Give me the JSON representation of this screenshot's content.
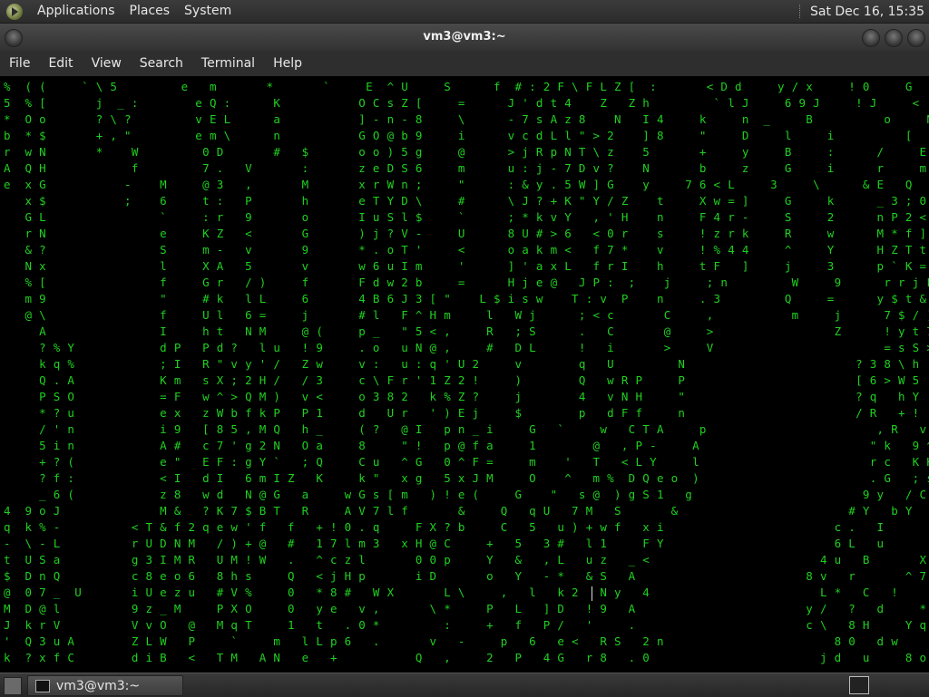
{
  "top_panel": {
    "menu": [
      "Applications",
      "Places",
      "System"
    ],
    "clock": "Sat Dec 16, 15:35"
  },
  "window": {
    "title": "vm3@vm3:~",
    "menu": [
      "File",
      "Edit",
      "View",
      "Search",
      "Terminal",
      "Help"
    ]
  },
  "terminal": {
    "content": "%  ( (     ` \\ 5         e   m       *       `     E  ^ U     S      f  # : 2 F \\ F L Z [  :       < D d     y / x     ! 0     G    U F ?\n5  % [       j  _ :        e Q :      K           O C s Z [     =      J ' d t 4    Z   Z h         ` l J     6 9 J     ! J     <    ? 1 6\n*  O o       ? \\ ?         v E L      a           ] - n - 8     \\      - 7 s A z 8    N   I 4     k     n  _     B          o     N    [ I .\nb  * $       + , \"         e m \\      n           G O @ b 9     i      v c d L l \" > 2    ] 8     \"     D     l     i          [     \"    Z . C\nr  w N       *    W         0 D       #   $       o o ) 5 g     @      > j R p N T \\ z    5       +     y     B     :      /     E     $    r t\nA  Q H            f         7 .   V       :       z e D S 6     m      u : j - 7 D v ?    N       b     z     G     i      r     m     e    %\ne  x G           -    M     @ 3   ,       M       x r W n ;     \"      : & y . 5 W ] G    y     7 6 < L     3     \\      & E   Q     m    =\n   x $           ;    6     t :   P       h       e T Y D \\     #      \\ J ? + K \" Y / Z    t     X w = ]     G     k      _ 3 ; 0     A    V\n   G L                `     : r   9       o       I u S l $     `      ; * k v Y   , ' H    n     F 4 r -     S     2      n P 2 <     p    P\n   r N                e     K Z   <       G       ) j ? V -     U      8 U # > 6   < 0 r    s     ! z r k     R     w      M * f ]     Z    K\n   & ?                S     m -   v       9       * . o T '     <      o a k m <   f 7 *    v     ! % 4 4     ^     Y      H Z T t     \\    i\n   N x                l     X A   5       v       w 6 u I m     '      ] ' a x L   f r I    h     t F   ]     j     3      p ` K =     i    Z\n   % [                f     G r   / )     f       F d w 2 b     =      H j e @   J P :  ;    j     ; n         W     9      r r j F     i    V\n   m 9                \"     # k   l L     6       4 B 6 J 3 [ \"    L $ i s w    T : v  P    n     . 3         Q     =      y $ t &     5    a\n   @ \\                f     U l   6 =     j       # l   F ^ H m     l   W j      ; < c       C     ,           m     j      7 $ / )     7    \\\n     A                I     h t   N M     @ (     p _   \" 5 < ,     R   ; S      .   C       @     >                 Z      ! y t 7 .\n     ? % Y            d P   P d ?   l u   ! 9     . o   u N @ ,     #   D L      !   i       >     V                        = s S >     h\n     k q %            ; I   R \" v y ' /   Z w     v :   u : q ' U 2     v        q   U         N                        ? 3 8 \\ h   I\n     Q . A            K m   s X ; 2 H /   / 3     c \\ F r ' 1 Z 2 !     )        Q   w R P     P                        [ 6 > W 5   \\\n     P S O            = F   w ^ > Q M )   v <     o 3 8 2   k % Z ?     j        4   v N H     \"                        ? q   h Y\n     * ? u            e x   z W b f k P   P 1     d   U r   ' ) E j     $        p   d F f     n                        / R   + !\n     / ' n            i 9   [ 8 5 , M Q   h _     ( ?   @ I   p n _ i     G   `     w   C T A     p                        , R   v :\n     5 i n            A #   c 7 ' g 2 N   O a     8     \" !   p @ f a     1        @   , P -     A                        \" k   9 ^\n     + ? (            e \"   E F : g Y `   ; Q     C u   ^ G   0 ^ F =     m    '   T   < L Y     l                        r c   K K     L\n     ? f :            < I   d I   6 m I Z   K     k \"   x g   5 x J M     O    ^   m %  D Q e o  )                        . G   ; s     y\n     _ 6 (            z 8   w d   N @ G   a     w G s [ m   ) ! e (     G    \"   s @  ) g S 1   g                        9 y   / C     ,\n4  9 o J              M &   ? K 7 $ B T   R     A V 7 l f       &     Q   q U   7 M   S       &                        # Y   b Y     F\nq  k % -          < T & f 2 q e w ' f   f   + ! 0 . q     F X ? b     C   5   u ) + w f   x i                        c .   I       K\n-  \\ - L          r U D N M   / ) + @   #   1 7 l m 3   x H @ C     +   5   3 #   l 1     F Y                        6 L   u       \\\nt  U S a          g 3 I M R   U M ! W   .   ^ c z l       0 0 p     Y   &   , L   u z   _ <                        4 u   B       X , 9 t\n$  D n Q          c 8 e o 6   8 h s     Q   < j H p       i D       o   Y   - *   & S   A                        8 v   r       ^ 7 H H\n@  0 7 _  U       i U e z u   # V %     0   * 8 #   W X       L \\     ,   l   k 2   N y   4                        L *   C   !     ) m 5 #\nM  D @ l          9 z _ M     P X O     0   y e   v ,       \\ *     P   L   ] D   ! 9   A                        y /   ?   d     * - o l\nJ  k r V          V v O   @   M q T     1   t   . 0 *         :     +   f   P /   '     .                        c \\   8 H     Y q h [\n'  Q 3 u A        Z L W   P     `     m   l L p 6   .       v   -     p   6   e <   R S   2 n                        8 0   d w     1 . _ o\nk  ? x f C        d i B   <   T M   A N   e   +           Q   ,     2   P   4 G   r 8   . 0                        j d   u     8 o ) E #"
  },
  "taskbar": {
    "task_label": "vm3@vm3:~"
  },
  "icons": {
    "logo": "distro-logo-icon",
    "close": "close-icon",
    "maximize": "maximize-icon",
    "minimize": "minimize-icon",
    "show_desktop": "show-desktop-icon",
    "terminal": "terminal-icon",
    "tray": "tray-terminal-icon"
  },
  "colors": {
    "matrix_green": "#1fd11f",
    "background": "#000000"
  }
}
